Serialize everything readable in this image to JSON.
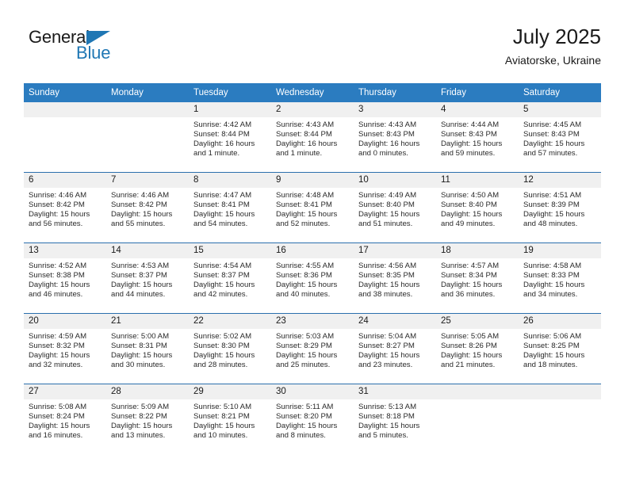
{
  "brand": {
    "line1": "General",
    "line2": "Blue",
    "triangle_icon": "blue-triangle-logo-mark",
    "accent_color": "#1f77b4"
  },
  "header": {
    "title": "July 2025",
    "subtitle": "Aviatorske, Ukraine"
  },
  "calendar": {
    "header_bg": "#2b7cc0",
    "daynum_bg": "#f0f0f0",
    "weekday_headers": [
      "Sunday",
      "Monday",
      "Tuesday",
      "Wednesday",
      "Thursday",
      "Friday",
      "Saturday"
    ],
    "labels": {
      "sunrise": "Sunrise:",
      "sunset": "Sunset:",
      "daylight": "Daylight:"
    },
    "weeks": [
      [
        {
          "day": "",
          "sunrise": "",
          "sunset": "",
          "daylight": ""
        },
        {
          "day": "",
          "sunrise": "",
          "sunset": "",
          "daylight": ""
        },
        {
          "day": "1",
          "sunrise": "Sunrise: 4:42 AM",
          "sunset": "Sunset: 8:44 PM",
          "daylight": "Daylight: 16 hours and 1 minute."
        },
        {
          "day": "2",
          "sunrise": "Sunrise: 4:43 AM",
          "sunset": "Sunset: 8:44 PM",
          "daylight": "Daylight: 16 hours and 1 minute."
        },
        {
          "day": "3",
          "sunrise": "Sunrise: 4:43 AM",
          "sunset": "Sunset: 8:43 PM",
          "daylight": "Daylight: 16 hours and 0 minutes."
        },
        {
          "day": "4",
          "sunrise": "Sunrise: 4:44 AM",
          "sunset": "Sunset: 8:43 PM",
          "daylight": "Daylight: 15 hours and 59 minutes."
        },
        {
          "day": "5",
          "sunrise": "Sunrise: 4:45 AM",
          "sunset": "Sunset: 8:43 PM",
          "daylight": "Daylight: 15 hours and 57 minutes."
        }
      ],
      [
        {
          "day": "6",
          "sunrise": "Sunrise: 4:46 AM",
          "sunset": "Sunset: 8:42 PM",
          "daylight": "Daylight: 15 hours and 56 minutes."
        },
        {
          "day": "7",
          "sunrise": "Sunrise: 4:46 AM",
          "sunset": "Sunset: 8:42 PM",
          "daylight": "Daylight: 15 hours and 55 minutes."
        },
        {
          "day": "8",
          "sunrise": "Sunrise: 4:47 AM",
          "sunset": "Sunset: 8:41 PM",
          "daylight": "Daylight: 15 hours and 54 minutes."
        },
        {
          "day": "9",
          "sunrise": "Sunrise: 4:48 AM",
          "sunset": "Sunset: 8:41 PM",
          "daylight": "Daylight: 15 hours and 52 minutes."
        },
        {
          "day": "10",
          "sunrise": "Sunrise: 4:49 AM",
          "sunset": "Sunset: 8:40 PM",
          "daylight": "Daylight: 15 hours and 51 minutes."
        },
        {
          "day": "11",
          "sunrise": "Sunrise: 4:50 AM",
          "sunset": "Sunset: 8:40 PM",
          "daylight": "Daylight: 15 hours and 49 minutes."
        },
        {
          "day": "12",
          "sunrise": "Sunrise: 4:51 AM",
          "sunset": "Sunset: 8:39 PM",
          "daylight": "Daylight: 15 hours and 48 minutes."
        }
      ],
      [
        {
          "day": "13",
          "sunrise": "Sunrise: 4:52 AM",
          "sunset": "Sunset: 8:38 PM",
          "daylight": "Daylight: 15 hours and 46 minutes."
        },
        {
          "day": "14",
          "sunrise": "Sunrise: 4:53 AM",
          "sunset": "Sunset: 8:37 PM",
          "daylight": "Daylight: 15 hours and 44 minutes."
        },
        {
          "day": "15",
          "sunrise": "Sunrise: 4:54 AM",
          "sunset": "Sunset: 8:37 PM",
          "daylight": "Daylight: 15 hours and 42 minutes."
        },
        {
          "day": "16",
          "sunrise": "Sunrise: 4:55 AM",
          "sunset": "Sunset: 8:36 PM",
          "daylight": "Daylight: 15 hours and 40 minutes."
        },
        {
          "day": "17",
          "sunrise": "Sunrise: 4:56 AM",
          "sunset": "Sunset: 8:35 PM",
          "daylight": "Daylight: 15 hours and 38 minutes."
        },
        {
          "day": "18",
          "sunrise": "Sunrise: 4:57 AM",
          "sunset": "Sunset: 8:34 PM",
          "daylight": "Daylight: 15 hours and 36 minutes."
        },
        {
          "day": "19",
          "sunrise": "Sunrise: 4:58 AM",
          "sunset": "Sunset: 8:33 PM",
          "daylight": "Daylight: 15 hours and 34 minutes."
        }
      ],
      [
        {
          "day": "20",
          "sunrise": "Sunrise: 4:59 AM",
          "sunset": "Sunset: 8:32 PM",
          "daylight": "Daylight: 15 hours and 32 minutes."
        },
        {
          "day": "21",
          "sunrise": "Sunrise: 5:00 AM",
          "sunset": "Sunset: 8:31 PM",
          "daylight": "Daylight: 15 hours and 30 minutes."
        },
        {
          "day": "22",
          "sunrise": "Sunrise: 5:02 AM",
          "sunset": "Sunset: 8:30 PM",
          "daylight": "Daylight: 15 hours and 28 minutes."
        },
        {
          "day": "23",
          "sunrise": "Sunrise: 5:03 AM",
          "sunset": "Sunset: 8:29 PM",
          "daylight": "Daylight: 15 hours and 25 minutes."
        },
        {
          "day": "24",
          "sunrise": "Sunrise: 5:04 AM",
          "sunset": "Sunset: 8:27 PM",
          "daylight": "Daylight: 15 hours and 23 minutes."
        },
        {
          "day": "25",
          "sunrise": "Sunrise: 5:05 AM",
          "sunset": "Sunset: 8:26 PM",
          "daylight": "Daylight: 15 hours and 21 minutes."
        },
        {
          "day": "26",
          "sunrise": "Sunrise: 5:06 AM",
          "sunset": "Sunset: 8:25 PM",
          "daylight": "Daylight: 15 hours and 18 minutes."
        }
      ],
      [
        {
          "day": "27",
          "sunrise": "Sunrise: 5:08 AM",
          "sunset": "Sunset: 8:24 PM",
          "daylight": "Daylight: 15 hours and 16 minutes."
        },
        {
          "day": "28",
          "sunrise": "Sunrise: 5:09 AM",
          "sunset": "Sunset: 8:22 PM",
          "daylight": "Daylight: 15 hours and 13 minutes."
        },
        {
          "day": "29",
          "sunrise": "Sunrise: 5:10 AM",
          "sunset": "Sunset: 8:21 PM",
          "daylight": "Daylight: 15 hours and 10 minutes."
        },
        {
          "day": "30",
          "sunrise": "Sunrise: 5:11 AM",
          "sunset": "Sunset: 8:20 PM",
          "daylight": "Daylight: 15 hours and 8 minutes."
        },
        {
          "day": "31",
          "sunrise": "Sunrise: 5:13 AM",
          "sunset": "Sunset: 8:18 PM",
          "daylight": "Daylight: 15 hours and 5 minutes."
        },
        {
          "day": "",
          "sunrise": "",
          "sunset": "",
          "daylight": ""
        },
        {
          "day": "",
          "sunrise": "",
          "sunset": "",
          "daylight": ""
        }
      ]
    ]
  }
}
